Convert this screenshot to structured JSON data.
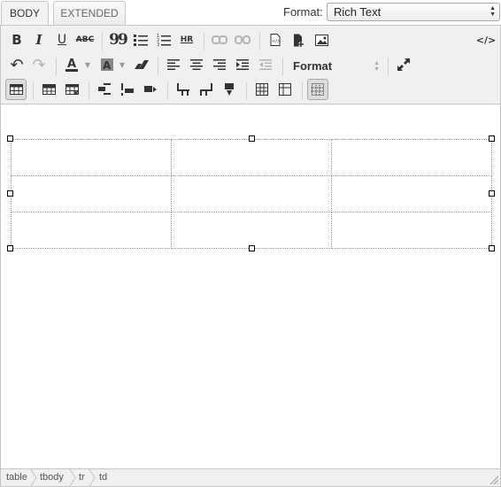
{
  "tabs": [
    {
      "label": "BODY",
      "active": true
    },
    {
      "label": "EXTENDED",
      "active": false
    }
  ],
  "format": {
    "label": "Format:",
    "value": "Rich Text"
  },
  "toolbar": {
    "format_dropdown": "Format",
    "source_code": "</>",
    "bold": "B",
    "italic": "I",
    "underline": "U",
    "strikethrough": "ABC",
    "blockquote": "99",
    "hr": "HR"
  },
  "table": {
    "rows": 3,
    "cols": 3
  },
  "breadcrumbs": [
    "table",
    "tbody",
    "tr",
    "td"
  ]
}
